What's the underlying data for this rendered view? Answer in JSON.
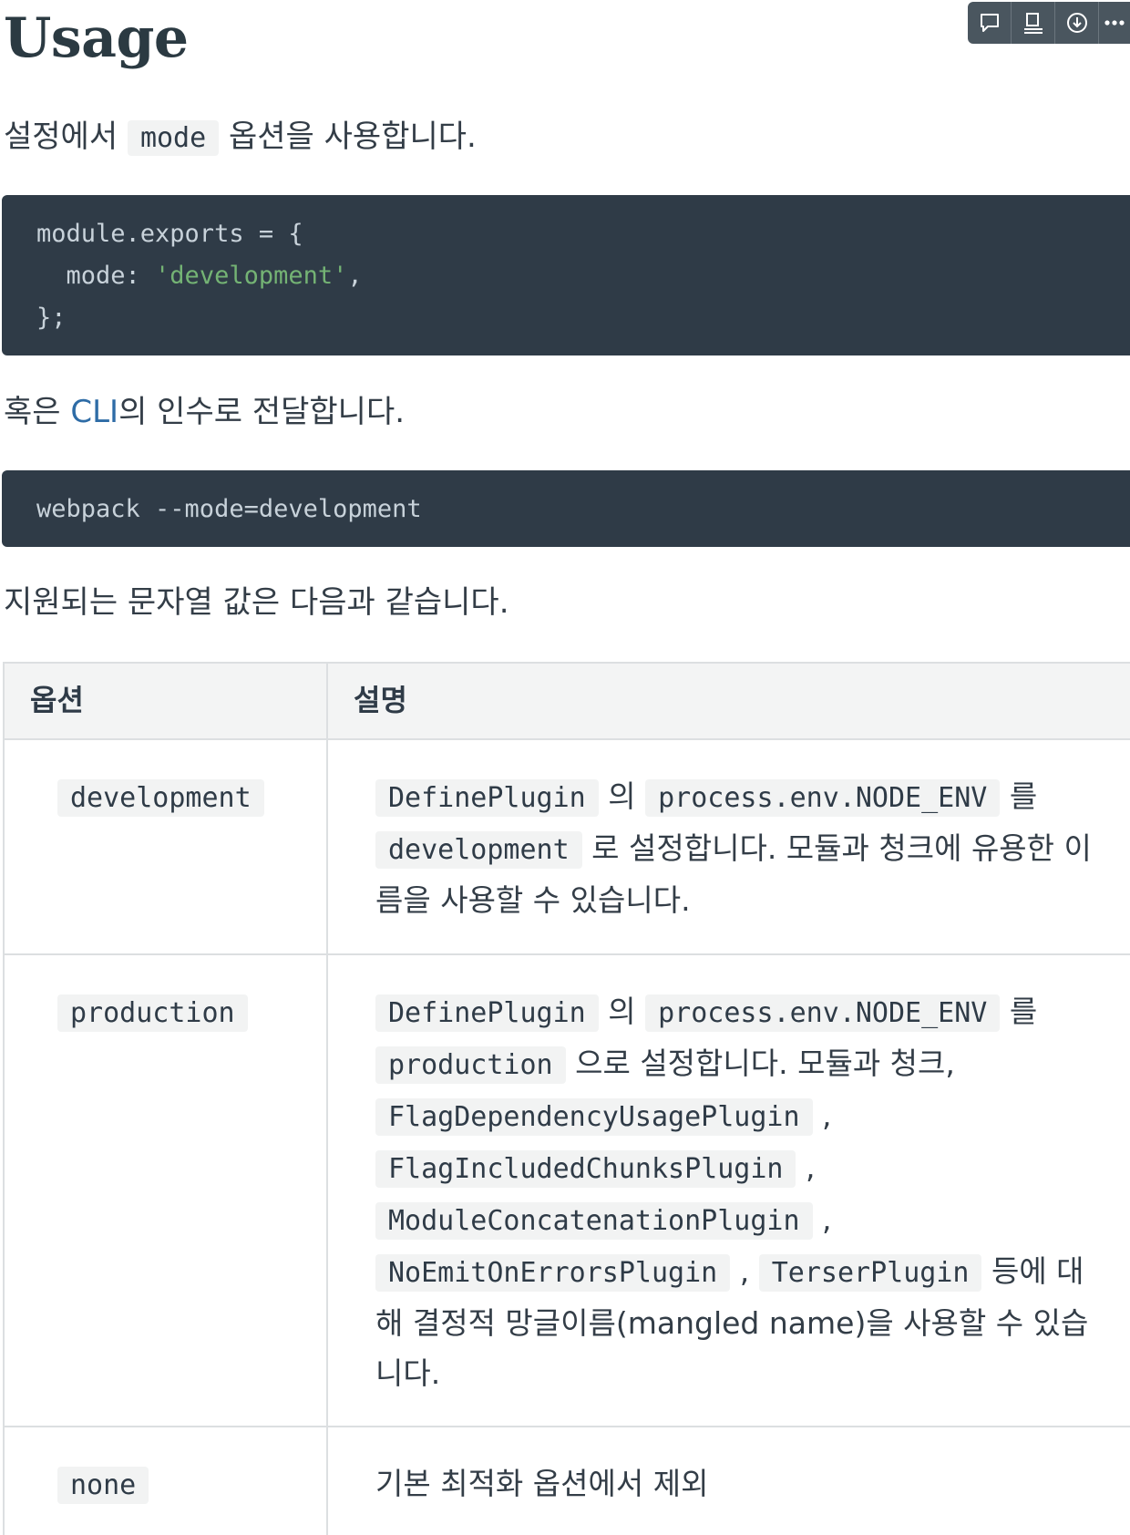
{
  "heading": {
    "title": "Usage"
  },
  "toolbar": {
    "buttons": [
      {
        "icon": "comment-icon"
      },
      {
        "icon": "outline-icon"
      },
      {
        "icon": "download-icon"
      },
      {
        "icon": "more-icon"
      }
    ]
  },
  "intro": {
    "before": "설정에서",
    "code": "mode",
    "after": "옵션을 사용합니다."
  },
  "config_code": {
    "line1": "module.exports = {",
    "line2_key": "  mode: ",
    "line2_value": "'development'",
    "line2_end": ",",
    "line3": "};"
  },
  "cli": {
    "before": "혹은 ",
    "link": "CLI",
    "after": "의 인수로 전달합니다."
  },
  "cli_code": {
    "line": "webpack --mode=development"
  },
  "supported": {
    "text": "지원되는 문자열 값은 다음과 같습니다."
  },
  "table": {
    "headers": [
      "옵션",
      "설명"
    ],
    "rows": [
      {
        "option": "development",
        "desc": {
          "code1": "DefinePlugin",
          "t1": " 의 ",
          "code2": "process.env.NODE_ENV",
          "t2": " 를 ",
          "code3": "development",
          "t3": " 로 설정합니다. 모듈과 청크에 유용한 이름을 사용할 수 있습니다."
        }
      },
      {
        "option": "production",
        "desc": {
          "code1": "DefinePlugin",
          "t1": " 의 ",
          "code2": "process.env.NODE_ENV",
          "t2": " 를 ",
          "code3": "production",
          "t3": " 으로 설정합니다. 모듈과 청크, ",
          "code4": "FlagDependencyUsagePlugin",
          "t4": " , ",
          "code5": "FlagIncludedChunksPlugin",
          "t5": " , ",
          "code6": "ModuleConcatenationPlugin",
          "t6": " , ",
          "code7": "NoEmitOnErrorsPlugin",
          "t7": " , ",
          "code8": "TerserPlugin",
          "t8": " 등에 대해 결정적 망글이름(mangled name)을 사용할 수 있습니다."
        }
      },
      {
        "option": "none",
        "desc": {
          "t1": "기본 최적화 옵션에서 제외"
        }
      }
    ]
  }
}
